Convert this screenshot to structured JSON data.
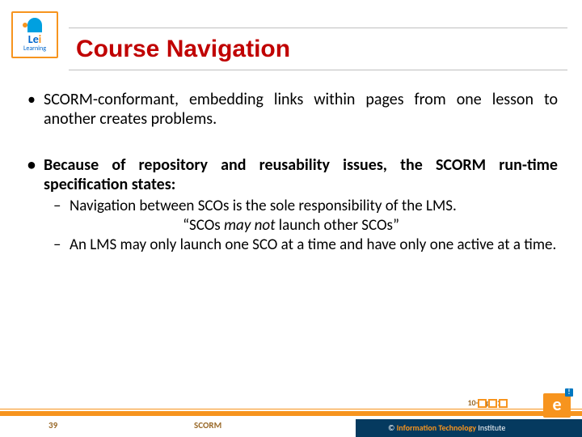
{
  "logo": {
    "brand_top": "Le",
    "brand_i": "i",
    "brand_sub": "Learning"
  },
  "title": "Course Navigation",
  "bullets": {
    "b1": "SCORM-conformant, embedding links within pages from one lesson to another creates problems.",
    "b2head": "Because of repository and reusability issues, the SCORM run-time specification states:",
    "sub1": "Navigation between SCOs is the sole responsibility of the LMS.",
    "quote_open": "“SCOs ",
    "quote_em": "may not",
    "quote_close": " launch other SCOs”",
    "sub2": "An LMS may only launch one SCO at a time and have only one active at a time."
  },
  "footer": {
    "page": "39",
    "center": "SCORM",
    "date": "10-Sep-21",
    "e": "e",
    "copy_sym": "© ",
    "copy_it": "Information Technology",
    "copy_inst": " Institute"
  }
}
